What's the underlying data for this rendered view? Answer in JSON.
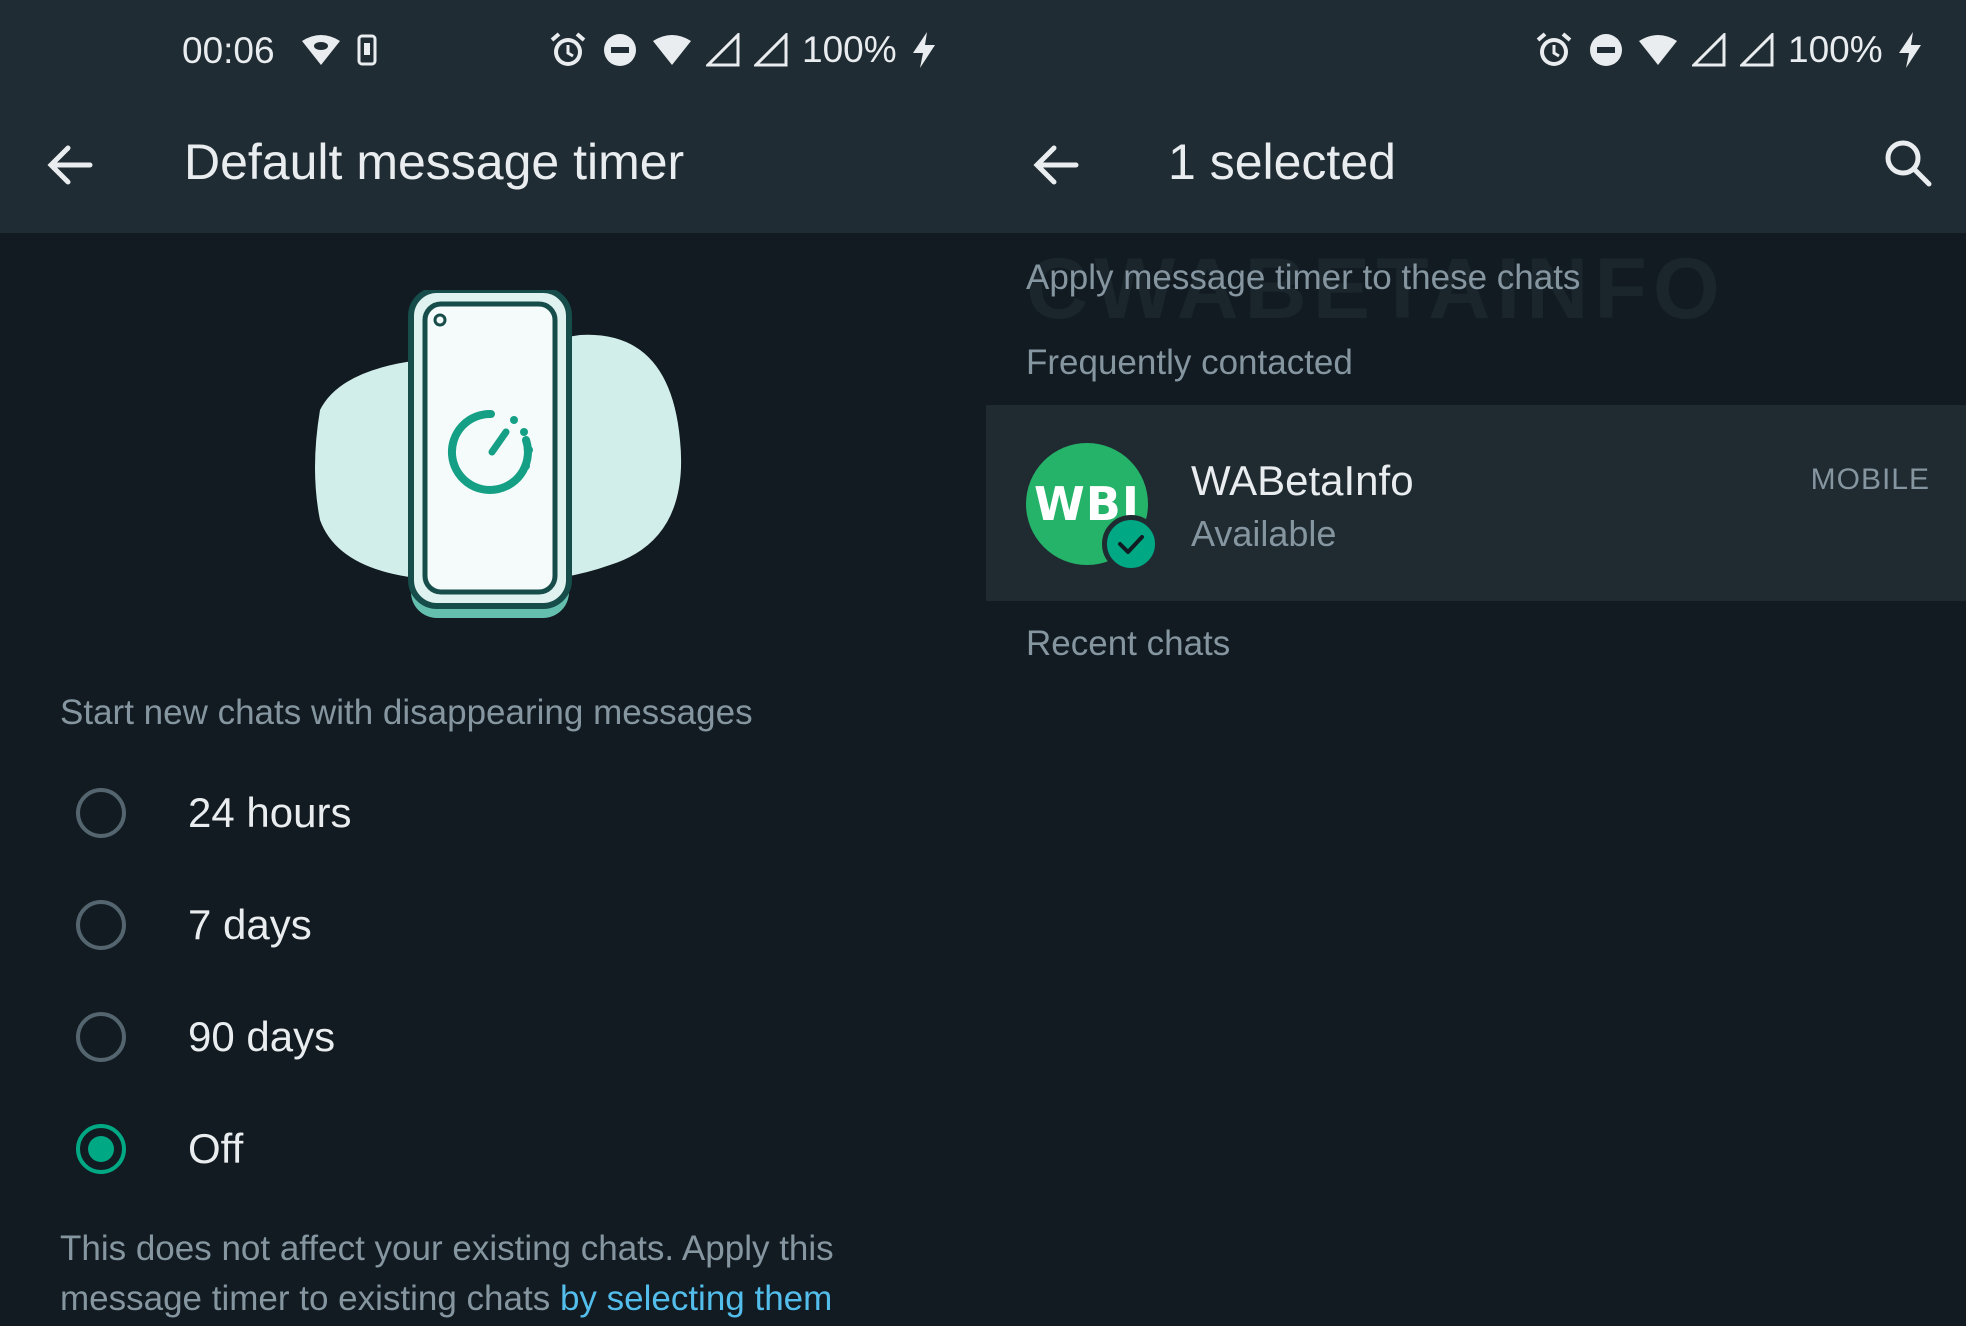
{
  "status_bar": {
    "time": "00:06",
    "battery": "100%"
  },
  "left_screen": {
    "title": "Default message timer",
    "section_label": "Start new chats with disappearing messages",
    "options": [
      {
        "label": "24 hours",
        "selected": false
      },
      {
        "label": "7 days",
        "selected": false
      },
      {
        "label": "90 days",
        "selected": false
      },
      {
        "label": "Off",
        "selected": true
      }
    ],
    "footer_text": "This does not affect your existing chats. Apply this message timer to existing chats ",
    "footer_link": "by selecting them"
  },
  "right_screen": {
    "title": "1 selected",
    "apply_label": "Apply  message timer to these chats",
    "frequent_label": "Frequently contacted",
    "contact": {
      "avatar_text": "WBI",
      "name": "WABetaInfo",
      "status": "Available",
      "tag": "MOBILE"
    },
    "recent_label": "Recent chats",
    "watermark": "CWABETAINFO"
  },
  "colors": {
    "accent": "#00a884",
    "link": "#53bdeb",
    "background": "#111b21",
    "header": "#202c33",
    "secondary_text": "#8696a0"
  },
  "icons": [
    "back-arrow-icon",
    "search-icon",
    "alarm-icon",
    "dnd-icon",
    "wifi-icon",
    "signal-icon",
    "charging-icon",
    "timer-icon",
    "check-icon"
  ]
}
